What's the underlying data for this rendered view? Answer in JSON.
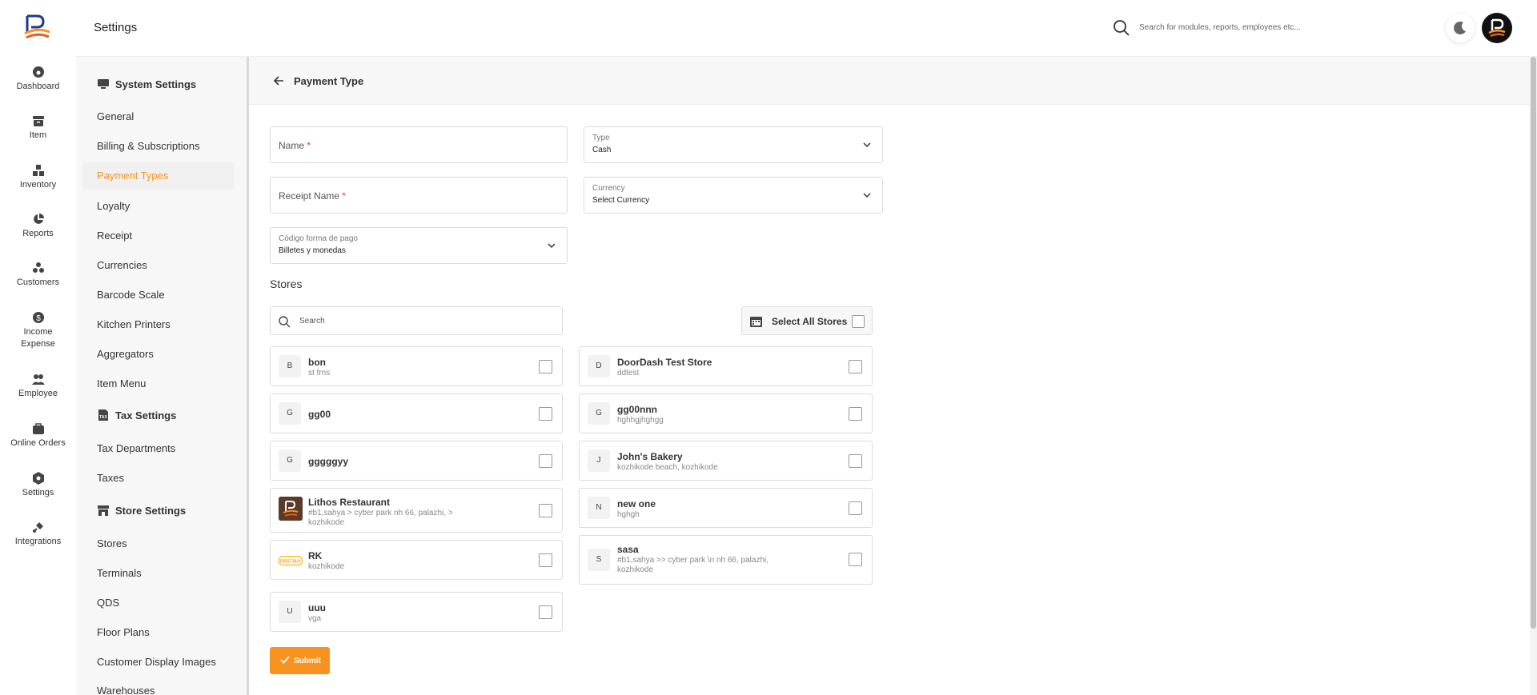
{
  "topbar": {
    "title": "Settings",
    "search_placeholder": "Search for modules, reports, employees etc..."
  },
  "rail": [
    {
      "label": "Dashboard",
      "icon": "dashboard-icon"
    },
    {
      "label": "Item",
      "icon": "item-icon"
    },
    {
      "label": "Inventory",
      "icon": "inventory-icon"
    },
    {
      "label": "Reports",
      "icon": "reports-icon"
    },
    {
      "label": "Customers",
      "icon": "customers-icon"
    },
    {
      "label": "Income Expense",
      "icon": "income-expense-icon"
    },
    {
      "label": "Employee",
      "icon": "employee-icon"
    },
    {
      "label": "Online Orders",
      "icon": "online-orders-icon"
    },
    {
      "label": "Settings",
      "icon": "settings-icon"
    },
    {
      "label": "Integrations",
      "icon": "integrations-icon"
    }
  ],
  "settings_nav": {
    "system_settings": "System Settings",
    "system_items": [
      "General",
      "Billing & Subscriptions",
      "Payment Types",
      "Loyalty",
      "Receipt",
      "Currencies",
      "Barcode Scale",
      "Kitchen Printers",
      "Aggregators",
      "Item Menu"
    ],
    "tax_settings": "Tax Settings",
    "tax_items": [
      "Tax Departments",
      "Taxes"
    ],
    "store_settings": "Store Settings",
    "store_items": [
      "Stores",
      "Terminals",
      "QDS",
      "Floor Plans",
      "Customer Display Images",
      "Warehouses"
    ],
    "active": "Payment Types"
  },
  "page": {
    "title": "Payment Type"
  },
  "form": {
    "name_placeholder": "Name",
    "receipt_name_placeholder": "Receipt Name",
    "required_mark": "*",
    "type_label": "Type",
    "type_value": "Cash",
    "currency_label": "Currency",
    "currency_value": "Select Currency",
    "codigo_label": "Código forma de pago",
    "codigo_value": "Billetes y monedas"
  },
  "stores": {
    "title": "Stores",
    "search_placeholder": "Search",
    "select_all_label": "Select All Stores",
    "left": [
      {
        "initial": "B",
        "name": "bon",
        "sub": "st frns"
      },
      {
        "initial": "G",
        "name": "gg00",
        "sub": ""
      },
      {
        "initial": "G",
        "name": "gggggyy",
        "sub": ""
      },
      {
        "initial": "",
        "name": "Lithos Restaurant",
        "sub": "#b1,sahya > cyber park nh 66, palazhi, > kozhikode"
      },
      {
        "initial": "",
        "name": "RK",
        "sub": "kozhikode"
      },
      {
        "initial": "U",
        "name": "uuu",
        "sub": "vga"
      }
    ],
    "right": [
      {
        "initial": "D",
        "name": "DoorDash Test Store",
        "sub": "ddtest"
      },
      {
        "initial": "G",
        "name": "gg00nnn",
        "sub": "hghhgjhghgg"
      },
      {
        "initial": "J",
        "name": "John's Bakery",
        "sub": "kozhikode beach, kozhikode"
      },
      {
        "initial": "N",
        "name": "new one",
        "sub": "hghgh"
      },
      {
        "initial": "S",
        "name": "sasa",
        "sub": "#b1,sahya >> cyber park \\n nh 66, palazhi, kozhikode"
      }
    ],
    "rk_logo_text": "FIRST BUY"
  },
  "submit_label": "Submit",
  "colors": {
    "accent": "#f7931e",
    "logo_blue": "#1b3a8c",
    "required": "#e53935"
  }
}
